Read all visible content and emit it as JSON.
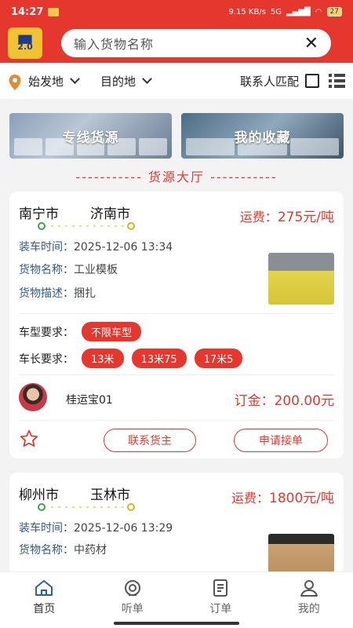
{
  "status": {
    "time": "14:27",
    "net": "9.15 KB/s",
    "signal": "5G",
    "battery": "27"
  },
  "app": {
    "logo_text": "2.0"
  },
  "search": {
    "placeholder": "输入货物名称"
  },
  "filters": {
    "origin": "始发地",
    "destination": "目的地",
    "contact_match": "联系人匹配"
  },
  "banners": [
    {
      "label": "专线货源"
    },
    {
      "label": "我的收藏"
    }
  ],
  "hall_title": "----------- 货源大厅 -----------",
  "labels": {
    "load_time": "装车时间：",
    "goods_name": "货物名称：",
    "goods_desc": "货物描述：",
    "vehicle_type": "车型要求：",
    "vehicle_length": "车长要求：",
    "contact_button": "联系货主",
    "apply_button": "申请接单"
  },
  "cards": [
    {
      "from": "南宁市",
      "to": "济南市",
      "fee_label": "运费：",
      "fee_value": "275元/吨",
      "load_time": "2025-12-06 13:34",
      "goods_name": "工业模板",
      "goods_desc": "捆扎",
      "vehicle_type": "不限车型",
      "lengths": [
        "13米",
        "13米75",
        "17米5"
      ],
      "owner": "桂运宝01",
      "deposit_label": "订金：",
      "deposit_value": "200.00元"
    },
    {
      "from": "柳州市",
      "to": "玉林市",
      "fee_label": "运费：",
      "fee_value": "1800元/吨",
      "load_time": "2025-12-06 13:29",
      "goods_name": "中药材"
    }
  ],
  "nav": [
    {
      "label": "首页",
      "icon": "home-icon",
      "active": true
    },
    {
      "label": "听单",
      "icon": "listen-icon"
    },
    {
      "label": "订单",
      "icon": "order-icon"
    },
    {
      "label": "我的",
      "icon": "user-icon"
    }
  ],
  "colors": {
    "brand": "#e5372d",
    "accent_yellow": "#e2b21a",
    "green": "#3fa34d"
  }
}
